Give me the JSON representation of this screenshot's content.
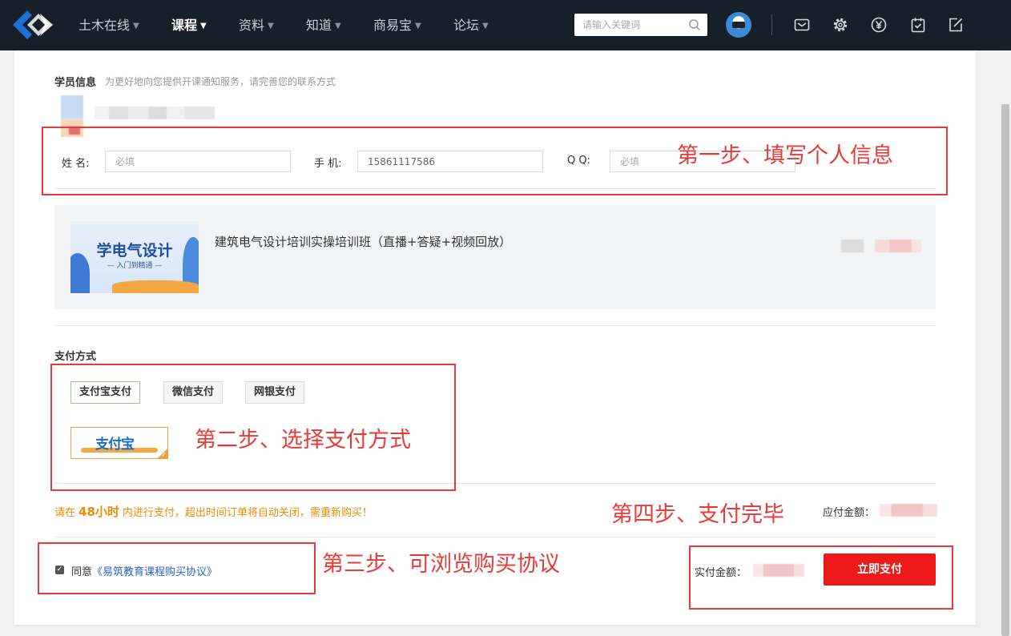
{
  "nav": {
    "items": [
      {
        "label": "土木在线",
        "active": false
      },
      {
        "label": "课程",
        "active": true
      },
      {
        "label": "资料",
        "active": false
      },
      {
        "label": "知道",
        "active": false
      },
      {
        "label": "商易宝",
        "active": false
      },
      {
        "label": "论坛",
        "active": false
      }
    ],
    "search_placeholder": "请输入关键词",
    "icons": [
      "mail-icon",
      "gear-icon",
      "yen-icon",
      "checklist-icon",
      "edit-icon"
    ]
  },
  "student": {
    "title": "学员信息",
    "subtitle": "为更好地向您提供开课通知服务，请完善您的联系方式",
    "name_label": "姓 名:",
    "name_placeholder": "必填",
    "phone_label": "手 机:",
    "phone_value": "15861117586",
    "qq_label": "Q Q:",
    "qq_placeholder": "必填"
  },
  "course": {
    "thumb_title": "学电气设计",
    "thumb_sub": "— 入门到精通 —",
    "title": "建筑电气设计培训实操培训班（直播+答疑+视频回放）"
  },
  "payment": {
    "title": "支付方式",
    "options": [
      "支付宝支付",
      "微信支付",
      "网银支付"
    ],
    "selected": 0,
    "alipay_logo_text": "支付宝"
  },
  "notice": {
    "prefix": "请在",
    "hours": "48小时",
    "suffix": "内进行支付，超出时间订单将自动关闭，需重新购买！"
  },
  "amounts": {
    "due_label": "应付金额：",
    "actual_label": "实付金额："
  },
  "agreement": {
    "prefix": "同意",
    "link": "《易筑教育课程购买协议》"
  },
  "submit_label": "立即支付",
  "annotations": {
    "step1": "第一步、填写个人信息",
    "step2": "第二步、选择支付方式",
    "step3": "第三步、可浏览购买协议",
    "step4": "第四步、支付完毕"
  },
  "colors": {
    "nav_bg": "#172029",
    "accent_red": "#ee1a1a",
    "notice_orange": "#f08a00",
    "annotation_red": "#e83a3a",
    "link_blue": "#2a64c5"
  }
}
